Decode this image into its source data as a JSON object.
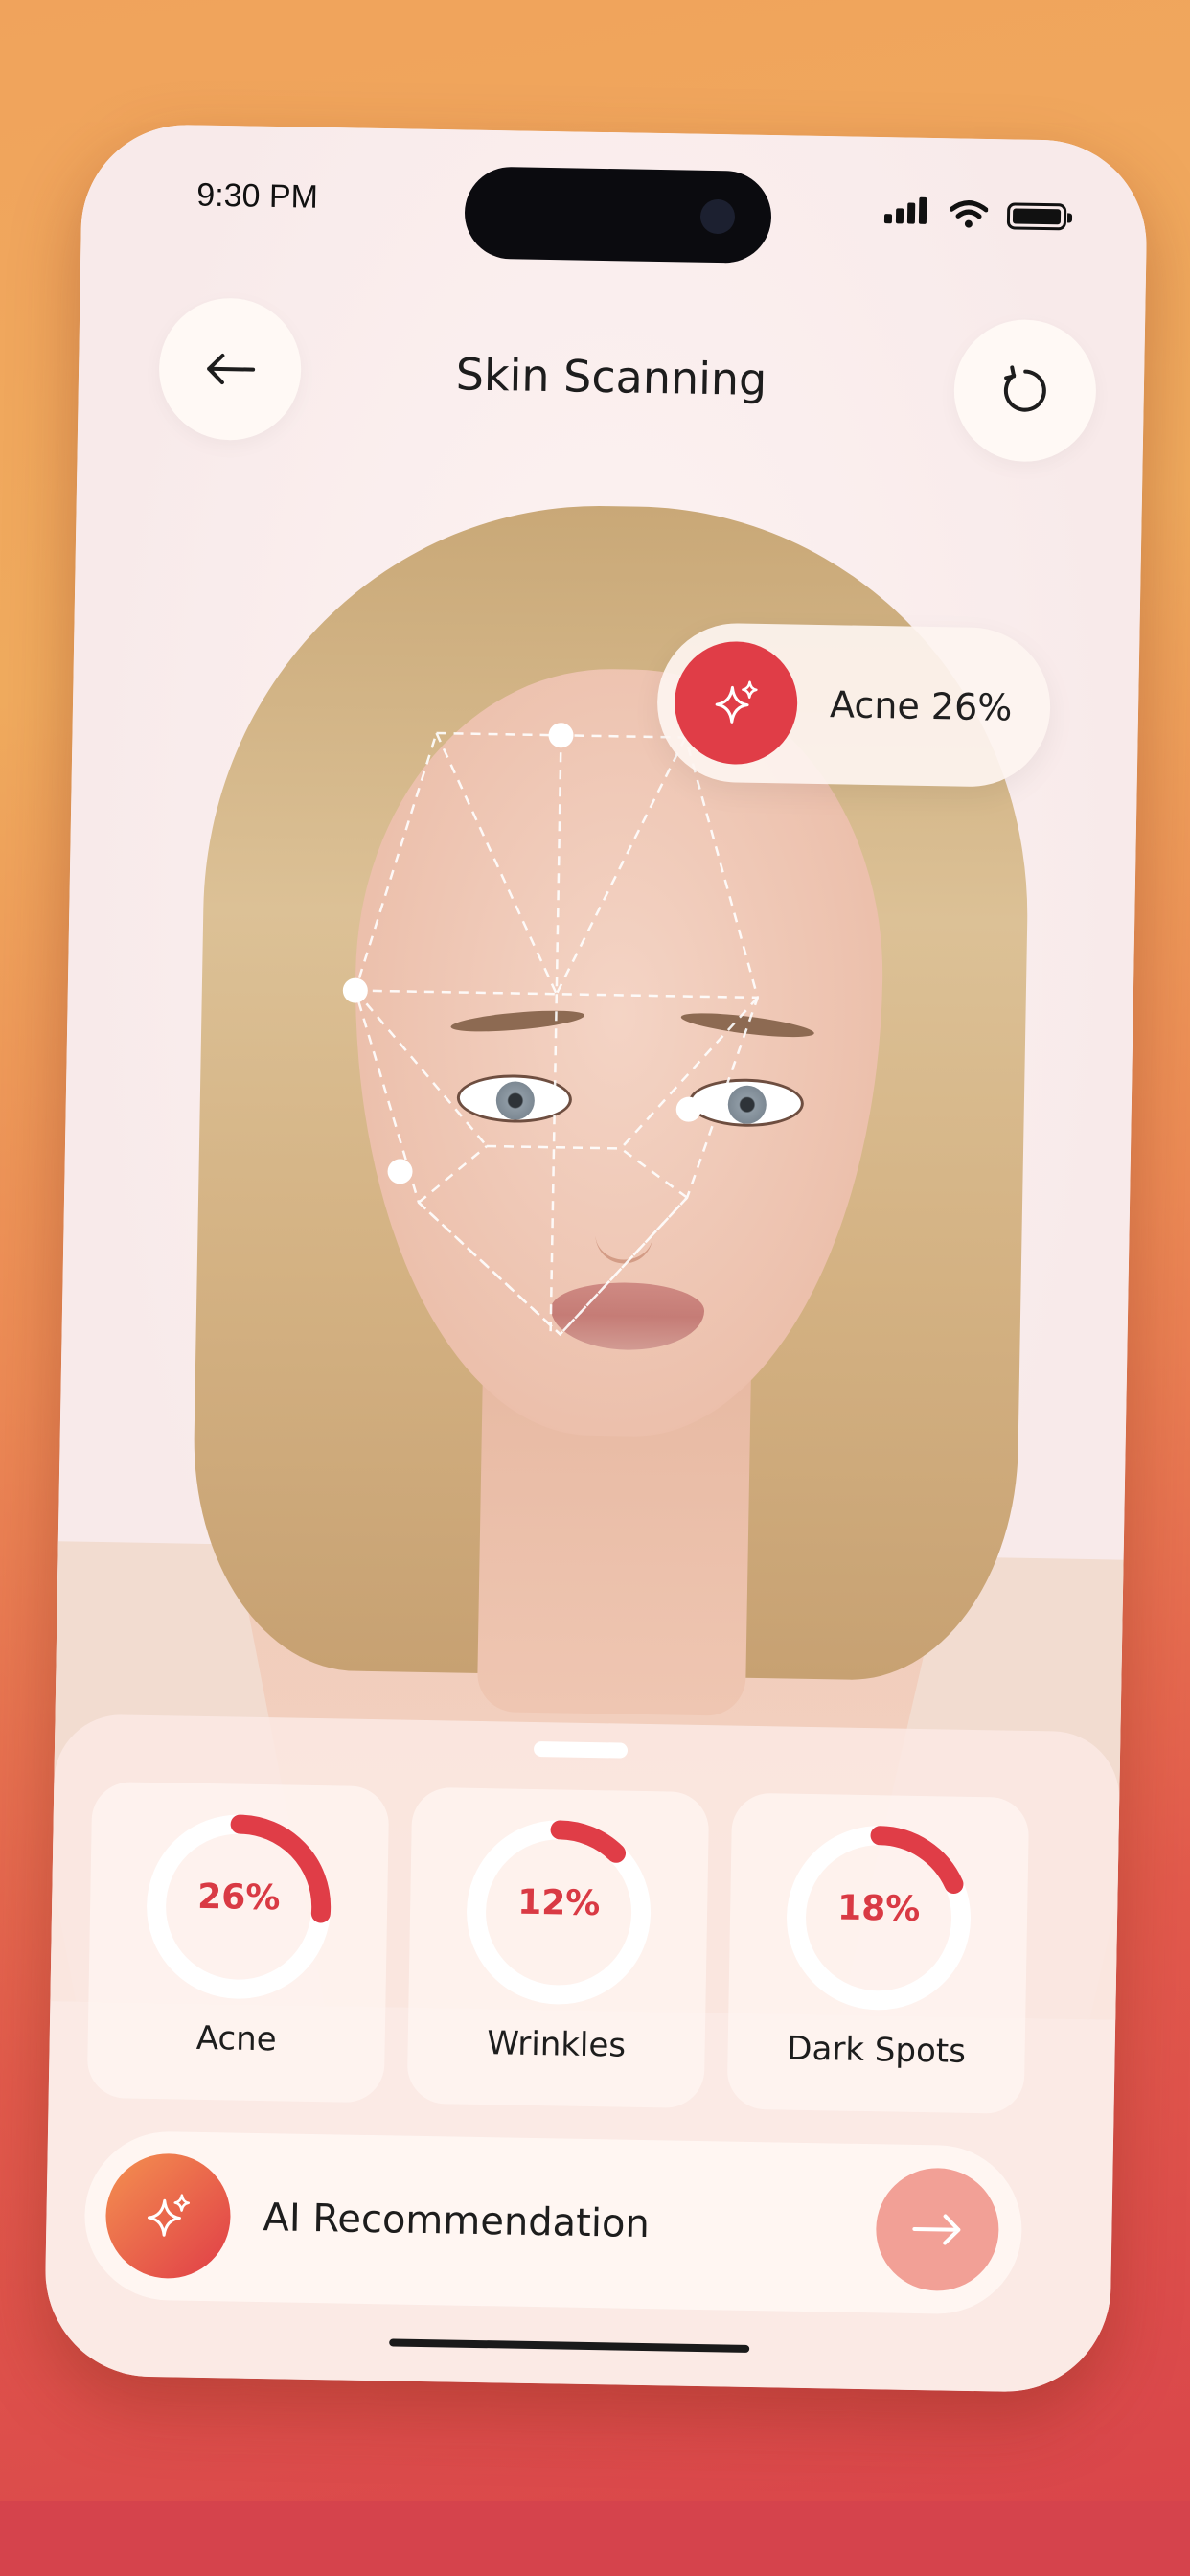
{
  "status_bar": {
    "time": "9:30 PM"
  },
  "header": {
    "title": "Skin Scanning",
    "back_icon": "arrow-left-icon",
    "reset_icon": "refresh-icon"
  },
  "acne_tag": {
    "label": "Acne 26%",
    "icon": "sparkle-icon",
    "accent": "#e03d47"
  },
  "metrics": [
    {
      "label": "Acne",
      "value_text": "26%",
      "value": 0.26
    },
    {
      "label": "Wrinkles",
      "value_text": "12%",
      "value": 0.12
    },
    {
      "label": "Dark Spots",
      "value_text": "18%",
      "value": 0.18
    }
  ],
  "ai_recommendation": {
    "label": "AI Recommendation",
    "icon": "sparkle-icon",
    "action_icon": "arrow-right-icon"
  },
  "colors": {
    "accent": "#e03d47",
    "ring_track": "#ffffff",
    "arrow_button": "#f2a096"
  }
}
